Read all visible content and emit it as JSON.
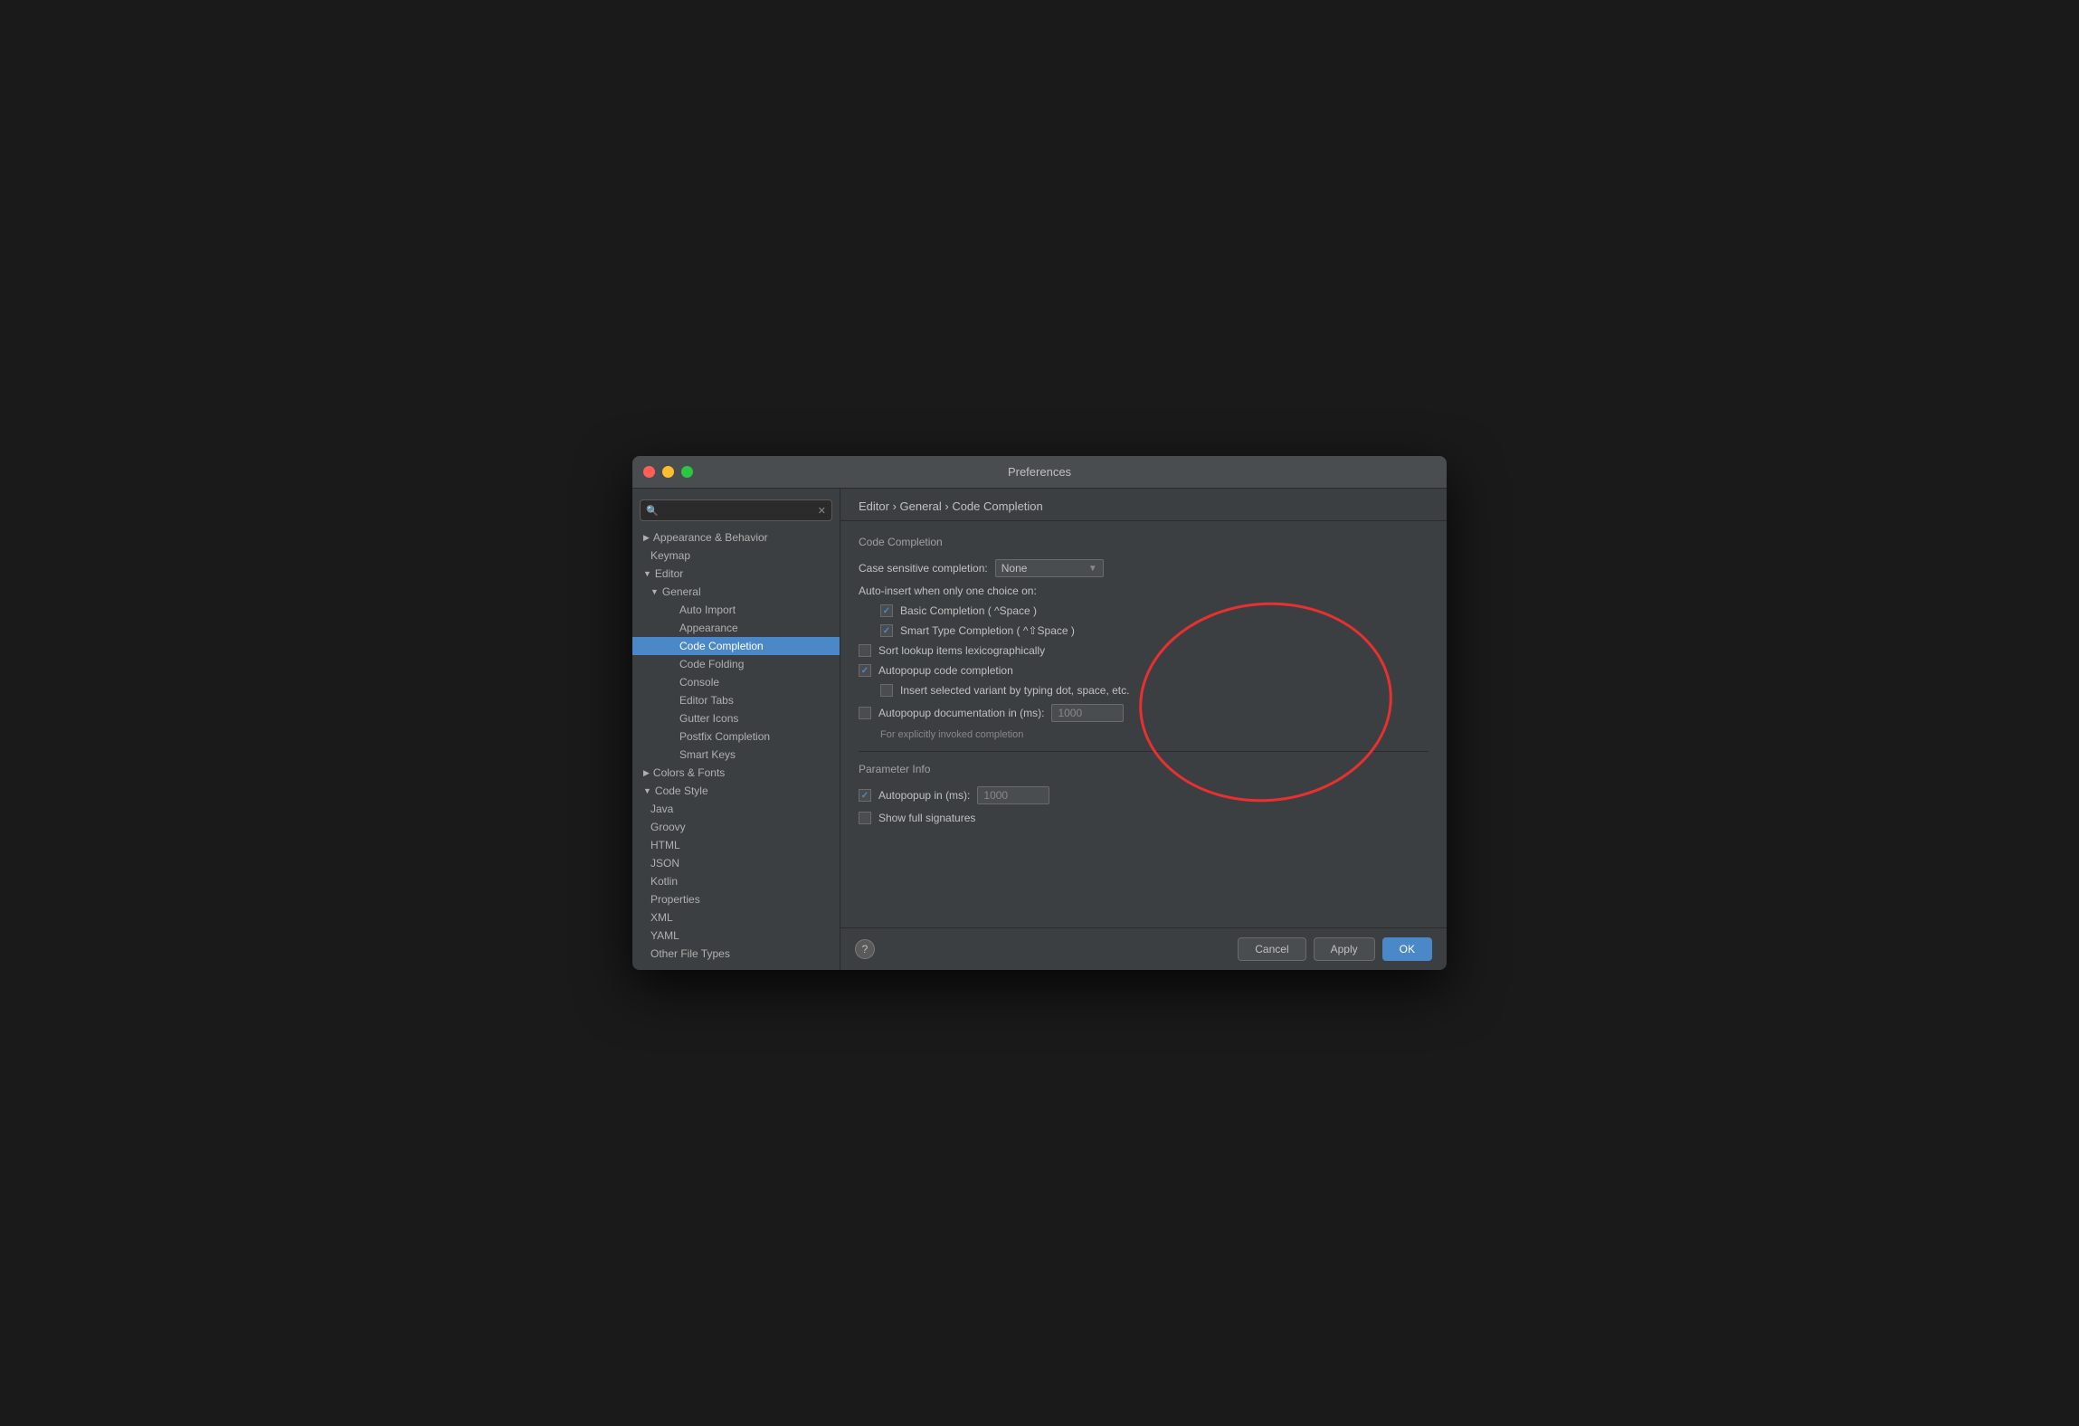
{
  "window": {
    "title": "Preferences"
  },
  "sidebar": {
    "search_placeholder": "",
    "items": [
      {
        "id": "appearance-behavior",
        "label": "Appearance & Behavior",
        "level": "level0",
        "triangle": "▶",
        "active": false
      },
      {
        "id": "keymap",
        "label": "Keymap",
        "level": "level1",
        "triangle": "",
        "active": false
      },
      {
        "id": "editor",
        "label": "Editor",
        "level": "level0",
        "triangle": "▼",
        "active": false
      },
      {
        "id": "general",
        "label": "General",
        "level": "level1",
        "triangle": "▼",
        "active": false
      },
      {
        "id": "auto-import",
        "label": "Auto Import",
        "level": "level2",
        "triangle": "",
        "active": false
      },
      {
        "id": "appearance",
        "label": "Appearance",
        "level": "level2",
        "triangle": "",
        "active": false
      },
      {
        "id": "code-completion",
        "label": "Code Completion",
        "level": "level2",
        "triangle": "",
        "active": true
      },
      {
        "id": "code-folding",
        "label": "Code Folding",
        "level": "level2",
        "triangle": "",
        "active": false
      },
      {
        "id": "console",
        "label": "Console",
        "level": "level2",
        "triangle": "",
        "active": false
      },
      {
        "id": "editor-tabs",
        "label": "Editor Tabs",
        "level": "level2",
        "triangle": "",
        "active": false
      },
      {
        "id": "gutter-icons",
        "label": "Gutter Icons",
        "level": "level2",
        "triangle": "",
        "active": false
      },
      {
        "id": "postfix-completion",
        "label": "Postfix Completion",
        "level": "level2",
        "triangle": "",
        "active": false
      },
      {
        "id": "smart-keys",
        "label": "Smart Keys",
        "level": "level2",
        "triangle": "",
        "active": false
      },
      {
        "id": "colors-fonts",
        "label": "Colors & Fonts",
        "level": "level0",
        "triangle": "▶",
        "active": false
      },
      {
        "id": "code-style",
        "label": "Code Style",
        "level": "level0",
        "triangle": "▼",
        "active": false
      },
      {
        "id": "java",
        "label": "Java",
        "level": "level1",
        "triangle": "",
        "active": false
      },
      {
        "id": "groovy",
        "label": "Groovy",
        "level": "level1",
        "triangle": "",
        "active": false
      },
      {
        "id": "html",
        "label": "HTML",
        "level": "level1",
        "triangle": "",
        "active": false
      },
      {
        "id": "json",
        "label": "JSON",
        "level": "level1",
        "triangle": "",
        "active": false
      },
      {
        "id": "kotlin",
        "label": "Kotlin",
        "level": "level1",
        "triangle": "",
        "active": false
      },
      {
        "id": "properties",
        "label": "Properties",
        "level": "level1",
        "triangle": "",
        "active": false
      },
      {
        "id": "xml",
        "label": "XML",
        "level": "level1",
        "triangle": "",
        "active": false
      },
      {
        "id": "yaml",
        "label": "YAML",
        "level": "level1",
        "triangle": "",
        "active": false
      },
      {
        "id": "other-file-types",
        "label": "Other File Types",
        "level": "level1",
        "triangle": "",
        "active": false
      }
    ]
  },
  "breadcrumb": "Editor › General › Code Completion",
  "main": {
    "section_title": "Code Completion",
    "case_sensitive_label": "Case sensitive completion:",
    "case_sensitive_value": "None",
    "auto_insert_label": "Auto-insert when only one choice on:",
    "basic_completion_label": "Basic Completion ( ^Space )",
    "basic_completion_checked": true,
    "smart_type_label": "Smart Type Completion ( ^⇧Space )",
    "smart_type_checked": true,
    "sort_lookup_label": "Sort lookup items lexicographically",
    "sort_lookup_checked": false,
    "autopopup_label": "Autopopup code completion",
    "autopopup_checked": true,
    "insert_variant_label": "Insert selected variant by typing dot, space, etc.",
    "insert_variant_checked": false,
    "autopopup_doc_label": "Autopopup documentation in (ms):",
    "autopopup_doc_checked": false,
    "autopopup_doc_value": "1000",
    "autopopup_doc_sublabel": "For explicitly invoked completion",
    "parameter_info_title": "Parameter Info",
    "autopopup_param_label": "Autopopup in (ms):",
    "autopopup_param_checked": true,
    "autopopup_param_value": "1000",
    "show_full_signatures_label": "Show full signatures",
    "show_full_signatures_checked": false
  },
  "footer": {
    "help_label": "?",
    "cancel_label": "Cancel",
    "apply_label": "Apply",
    "ok_label": "OK"
  }
}
